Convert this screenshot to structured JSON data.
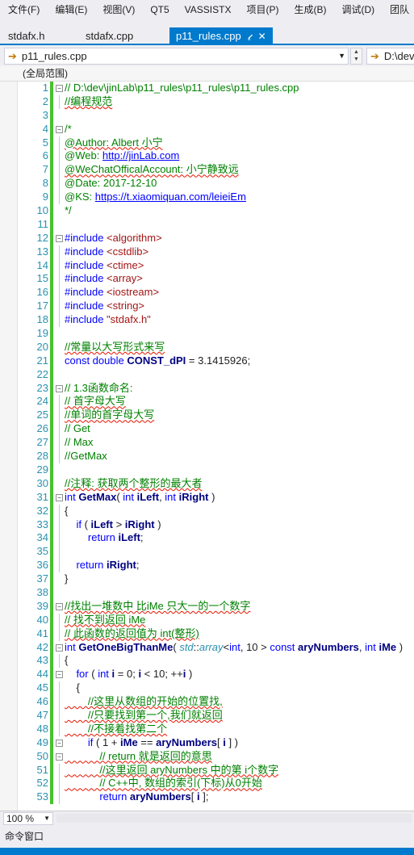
{
  "menu": [
    "文件(F)",
    "编辑(E)",
    "视图(V)",
    "QT5",
    "VASSISTX",
    "项目(P)",
    "生成(B)",
    "调试(D)",
    "团队"
  ],
  "tabs": [
    {
      "label": "stdafx.h",
      "active": false
    },
    {
      "label": "stdafx.cpp",
      "active": false
    },
    {
      "label": "p11_rules.cpp",
      "active": true,
      "pin_icon": "pin-icon",
      "close_icon": "close-icon"
    }
  ],
  "nav": {
    "file_dropdown": "p11_rules.cpp",
    "path_dropdown": "D:\\dev",
    "arrow_icon": "arrow-right-icon"
  },
  "scope": "(全局范围)",
  "colors": {
    "accent": "#007acc",
    "comment": "#008000",
    "keyword": "#0000ff",
    "string": "#a31515",
    "linenumber": "#2b91af",
    "changebar": "#47c22f"
  },
  "code": [
    {
      "n": "1",
      "fold": "−",
      "t": [
        {
          "c": "c-g",
          "v": "// D:\\dev\\jinLab\\p11_rules\\p11_rules\\p11_rules.cpp"
        }
      ]
    },
    {
      "n": "2",
      "t": [
        {
          "c": "c-g",
          "v": "//编程规范"
        }
      ]
    },
    {
      "n": "3",
      "t": []
    },
    {
      "n": "4",
      "fold": "−",
      "t": [
        {
          "c": "c-g",
          "v": "/*"
        }
      ]
    },
    {
      "n": "5",
      "t": [
        {
          "c": "c-g",
          "v": "@Author: Albert 小宁"
        }
      ]
    },
    {
      "n": "6",
      "t": [
        {
          "c": "c-g",
          "v": "@Web: "
        },
        {
          "c": "c-l",
          "v": "http://jinLab.com"
        }
      ]
    },
    {
      "n": "7",
      "t": [
        {
          "c": "c-g",
          "v": "@WeChatOfficalAccount: 小宁静致远"
        }
      ]
    },
    {
      "n": "8",
      "t": [
        {
          "c": "c-g",
          "v": "@Date: 2017-12-10"
        }
      ]
    },
    {
      "n": "9",
      "t": [
        {
          "c": "c-g",
          "v": "@KS: "
        },
        {
          "c": "c-l",
          "v": "https://t.xiaomiquan.com/leieiEm"
        }
      ]
    },
    {
      "n": "10",
      "t": [
        {
          "c": "c-g",
          "v": "*/"
        }
      ]
    },
    {
      "n": "11",
      "t": []
    },
    {
      "n": "12",
      "fold": "−",
      "t": [
        {
          "c": "c-k",
          "v": "#include "
        },
        {
          "c": "c-s",
          "v": "<algorithm>"
        }
      ]
    },
    {
      "n": "13",
      "t": [
        {
          "c": "c-k",
          "v": "#include "
        },
        {
          "c": "c-s",
          "v": "<cstdlib>"
        }
      ]
    },
    {
      "n": "14",
      "t": [
        {
          "c": "c-k",
          "v": "#include "
        },
        {
          "c": "c-s",
          "v": "<ctime>"
        }
      ]
    },
    {
      "n": "15",
      "t": [
        {
          "c": "c-k",
          "v": "#include "
        },
        {
          "c": "c-s",
          "v": "<array>"
        }
      ]
    },
    {
      "n": "16",
      "t": [
        {
          "c": "c-k",
          "v": "#include "
        },
        {
          "c": "c-s",
          "v": "<iostream>"
        }
      ]
    },
    {
      "n": "17",
      "t": [
        {
          "c": "c-k",
          "v": "#include "
        },
        {
          "c": "c-s",
          "v": "<string>"
        }
      ]
    },
    {
      "n": "18",
      "t": [
        {
          "c": "c-k",
          "v": "#include "
        },
        {
          "c": "c-s",
          "v": "\"stdafx.h\""
        }
      ]
    },
    {
      "n": "19",
      "t": []
    },
    {
      "n": "20",
      "t": [
        {
          "c": "c-g",
          "v": "//常量以大写形式来写"
        }
      ]
    },
    {
      "n": "21",
      "t": [
        {
          "c": "c-k",
          "v": "const double "
        },
        {
          "c": "c-b",
          "v": "CONST_dPI"
        },
        {
          "c": "",
          "v": " = 3.1415926;"
        }
      ]
    },
    {
      "n": "22",
      "t": []
    },
    {
      "n": "23",
      "fold": "−",
      "t": [
        {
          "c": "c-g",
          "v": "// 1.3函数命名: "
        }
      ]
    },
    {
      "n": "24",
      "t": [
        {
          "c": "c-g",
          "v": "// 首字母大写"
        }
      ]
    },
    {
      "n": "25",
      "t": [
        {
          "c": "c-g",
          "v": "//单词的首字母大写"
        }
      ]
    },
    {
      "n": "26",
      "t": [
        {
          "c": "c-g",
          "v": "// Get"
        }
      ]
    },
    {
      "n": "27",
      "t": [
        {
          "c": "c-g",
          "v": "// Max"
        }
      ]
    },
    {
      "n": "28",
      "t": [
        {
          "c": "c-g",
          "v": "//GetMax"
        }
      ]
    },
    {
      "n": "29",
      "t": []
    },
    {
      "n": "30",
      "t": [
        {
          "c": "c-g",
          "v": "//注释: 获取两个整形的最大者"
        }
      ]
    },
    {
      "n": "31",
      "fold": "−",
      "t": [
        {
          "c": "c-k",
          "v": "int "
        },
        {
          "c": "c-b",
          "v": "GetMax"
        },
        {
          "c": "",
          "v": "( "
        },
        {
          "c": "c-k",
          "v": "int "
        },
        {
          "c": "c-b",
          "v": "iLeft"
        },
        {
          "c": "",
          "v": ", "
        },
        {
          "c": "c-k",
          "v": "int "
        },
        {
          "c": "c-b",
          "v": "iRight"
        },
        {
          "c": "",
          "v": " )"
        }
      ]
    },
    {
      "n": "32",
      "t": [
        {
          "c": "",
          "v": "{"
        }
      ]
    },
    {
      "n": "33",
      "t": [
        {
          "c": "c-k",
          "v": "    if "
        },
        {
          "c": "",
          "v": "( "
        },
        {
          "c": "c-b",
          "v": "iLeft"
        },
        {
          "c": "",
          "v": " > "
        },
        {
          "c": "c-b",
          "v": "iRight"
        },
        {
          "c": "",
          "v": " )"
        }
      ]
    },
    {
      "n": "34",
      "t": [
        {
          "c": "c-k",
          "v": "        return "
        },
        {
          "c": "c-b",
          "v": "iLeft"
        },
        {
          "c": "",
          "v": ";"
        }
      ]
    },
    {
      "n": "35",
      "t": []
    },
    {
      "n": "36",
      "t": [
        {
          "c": "c-k",
          "v": "    return "
        },
        {
          "c": "c-b",
          "v": "iRight"
        },
        {
          "c": "",
          "v": ";"
        }
      ]
    },
    {
      "n": "37",
      "t": [
        {
          "c": "",
          "v": "}"
        }
      ]
    },
    {
      "n": "38",
      "t": []
    },
    {
      "n": "39",
      "fold": "−",
      "t": [
        {
          "c": "c-g",
          "v": "//找出一堆数中 比iMe 只大一的一个数字"
        }
      ]
    },
    {
      "n": "40",
      "t": [
        {
          "c": "c-g",
          "v": "// 找不到返回 iMe"
        }
      ]
    },
    {
      "n": "41",
      "t": [
        {
          "c": "c-g",
          "v": "// 此函数的返回值为 int(整形)"
        }
      ]
    },
    {
      "n": "42",
      "fold": "−",
      "t": [
        {
          "c": "c-k",
          "v": "int "
        },
        {
          "c": "c-b",
          "v": "GetOneBigThanMe"
        },
        {
          "c": "",
          "v": "( "
        },
        {
          "c": "c-t",
          "v": "std"
        },
        {
          "c": "",
          "v": "::"
        },
        {
          "c": "c-t",
          "v": "array"
        },
        {
          "c": "",
          "v": "<"
        },
        {
          "c": "c-k",
          "v": "int"
        },
        {
          "c": "",
          "v": ", 10 > "
        },
        {
          "c": "c-k",
          "v": "const "
        },
        {
          "c": "c-b",
          "v": "aryNumbers"
        },
        {
          "c": "",
          "v": ", "
        },
        {
          "c": "c-k",
          "v": "int "
        },
        {
          "c": "c-b",
          "v": "iMe"
        },
        {
          "c": "",
          "v": " )"
        }
      ]
    },
    {
      "n": "43",
      "t": [
        {
          "c": "",
          "v": "{"
        }
      ]
    },
    {
      "n": "44",
      "fold": "−",
      "t": [
        {
          "c": "c-k",
          "v": "    for "
        },
        {
          "c": "",
          "v": "( "
        },
        {
          "c": "c-k",
          "v": "int "
        },
        {
          "c": "c-b",
          "v": "i"
        },
        {
          "c": "",
          "v": " = 0; "
        },
        {
          "c": "c-b",
          "v": "i"
        },
        {
          "c": "",
          "v": " < 10; ++"
        },
        {
          "c": "c-b",
          "v": "i"
        },
        {
          "c": "",
          "v": " )"
        }
      ]
    },
    {
      "n": "45",
      "t": [
        {
          "c": "",
          "v": "    {"
        }
      ]
    },
    {
      "n": "46",
      "t": [
        {
          "c": "c-g",
          "v": "        //这里从数组的开始的位置找,"
        }
      ]
    },
    {
      "n": "47",
      "t": [
        {
          "c": "c-g",
          "v": "        //只要找到第一个,我们就返回"
        }
      ]
    },
    {
      "n": "48",
      "t": [
        {
          "c": "c-g",
          "v": "        //不接着找第二个"
        }
      ]
    },
    {
      "n": "49",
      "fold": "−",
      "t": [
        {
          "c": "c-k",
          "v": "        if "
        },
        {
          "c": "",
          "v": "( 1 + "
        },
        {
          "c": "c-b",
          "v": "iMe"
        },
        {
          "c": "",
          "v": " == "
        },
        {
          "c": "c-b",
          "v": "aryNumbers"
        },
        {
          "c": "",
          "v": "[ "
        },
        {
          "c": "c-b",
          "v": "i"
        },
        {
          "c": "",
          "v": " ] )"
        }
      ]
    },
    {
      "n": "50",
      "fold": "−",
      "t": [
        {
          "c": "c-g",
          "v": "            // return 就是返回的意思"
        }
      ]
    },
    {
      "n": "51",
      "t": [
        {
          "c": "c-g",
          "v": "            //这里返回 aryNumbers 中的第 i个数字"
        }
      ]
    },
    {
      "n": "52",
      "t": [
        {
          "c": "c-g",
          "v": "            // C++中, 数组的索引(下标)从0开始"
        }
      ]
    },
    {
      "n": "53",
      "t": [
        {
          "c": "c-k",
          "v": "            return "
        },
        {
          "c": "c-b",
          "v": "aryNumbers"
        },
        {
          "c": "",
          "v": "[ "
        },
        {
          "c": "c-b",
          "v": "i"
        },
        {
          "c": "",
          "v": " ];"
        }
      ]
    }
  ],
  "zoom": "100 %",
  "command_window": "命令窗口"
}
